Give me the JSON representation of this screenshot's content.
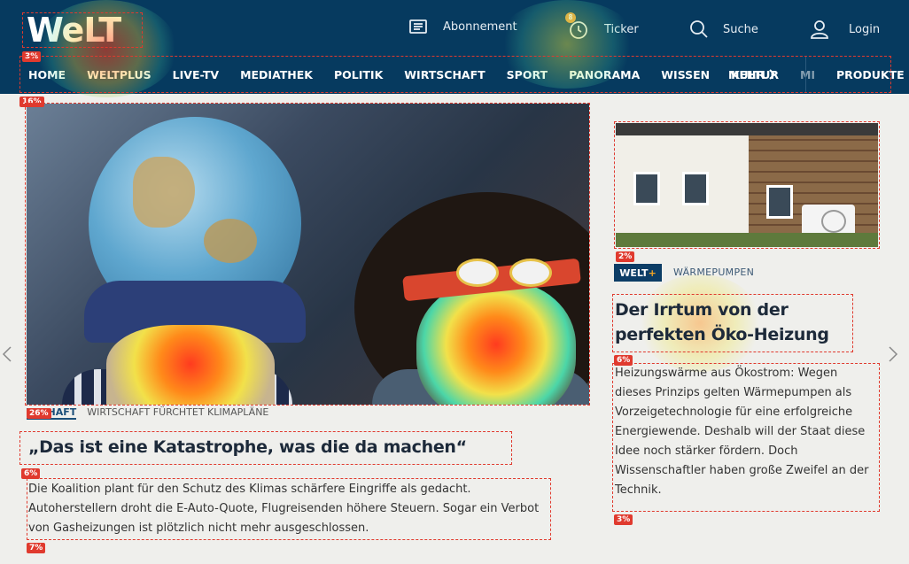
{
  "header": {
    "logo": "WeLT",
    "abo_label": "Abonnement",
    "ticker_label": "Ticker",
    "ticker_badge": "8",
    "search_label": "Suche",
    "login_label": "Login"
  },
  "nav": {
    "items": [
      "HOME",
      "WELTPLUS",
      "LIVE-TV",
      "MEDIATHEK",
      "POLITIK",
      "WIRTSCHAFT",
      "SPORT",
      "PANORAMA",
      "WISSEN",
      "KULTUR",
      "MI"
    ],
    "more_label": "MEHR",
    "products_label": "PRODUKTE"
  },
  "main_article": {
    "kicker_section": "TSCHAFT",
    "kicker_topic": "WIRTSCHAFT FÜRCHTET KLIMAPLÄNE",
    "headline": "„Das ist eine Katastrophe, was die da machen“",
    "teaser": "Die Koalition plant für den Schutz des Klimas schärfere Eingriffe als gedacht. Autoherstellern droht die E-Auto-Quote, Flugreisenden höhere Steuern. Sogar ein Verbot von Gasheizungen ist plötzlich nicht mehr ausgeschlossen."
  },
  "side_article": {
    "badge_prefix": "WELT",
    "badge_suffix": "+",
    "kicker": "WÄRMEPUMPEN",
    "headline": "Der Irrtum von der perfekten Öko-Heizung",
    "teaser": "Heizungswärme aus Ökostrom: Wegen dieses Prinzips gelten Wärmepumpen als Vorzeigetechnologie für eine erfolgreiche Energiewende. Deshalb will der Staat diese Idee noch stärker fördern. Doch Wissenschaftler haben große Zweifel an der Technik."
  },
  "heatmap_labels": {
    "logo": "3%",
    "nav": "16%",
    "main_image": "26%",
    "main_headline": "6%",
    "main_teaser": "7%",
    "side_image": "2%",
    "side_headline": "6%",
    "side_teaser": "3%"
  },
  "colors": {
    "header_bg": "#063a5f",
    "region_border": "#e03a2e",
    "page_bg": "#efefec"
  }
}
